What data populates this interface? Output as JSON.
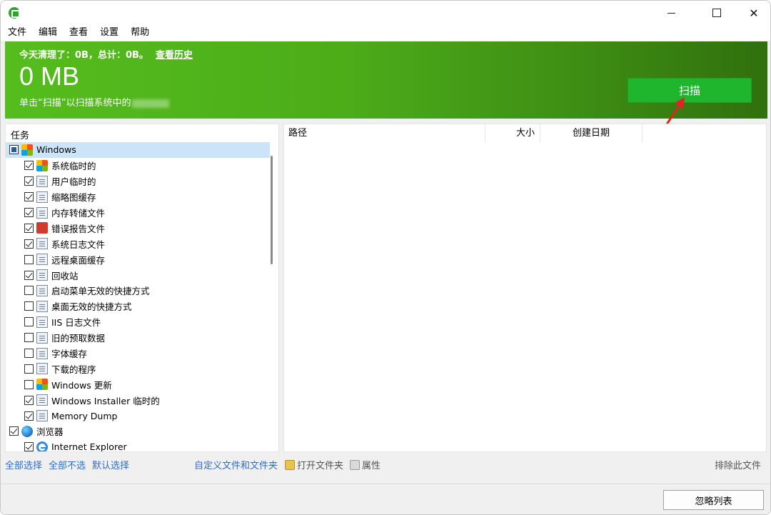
{
  "menu": [
    "文件",
    "编辑",
    "查看",
    "设置",
    "帮助"
  ],
  "banner": {
    "today_text": "今天清理了：0B，总计：0B。",
    "history_link": "查看历史",
    "total_size": "0 MB",
    "hint": "单击“扫描”以扫描系统中的",
    "scan_button": "扫描"
  },
  "tasks": {
    "header": "任务",
    "items": [
      {
        "label": "Windows",
        "level": 0,
        "check": "partial",
        "icon": "windows-icon",
        "selected": true
      },
      {
        "label": "系统临时的",
        "level": 1,
        "check": "checked",
        "icon": "windows-icon"
      },
      {
        "label": "用户临时的",
        "level": 1,
        "check": "checked",
        "icon": "document-icon"
      },
      {
        "label": "缩略图缓存",
        "level": 1,
        "check": "checked",
        "icon": "document-icon"
      },
      {
        "label": "内存转储文件",
        "level": 1,
        "check": "checked",
        "icon": "document-icon"
      },
      {
        "label": "错误报告文件",
        "level": 1,
        "check": "checked",
        "icon": "error-report-icon"
      },
      {
        "label": "系统日志文件",
        "level": 1,
        "check": "checked",
        "icon": "document-icon"
      },
      {
        "label": "远程桌面缓存",
        "level": 1,
        "check": "unchecked",
        "icon": "document-icon"
      },
      {
        "label": "回收站",
        "level": 1,
        "check": "checked",
        "icon": "document-icon"
      },
      {
        "label": "启动菜单无效的快捷方式",
        "level": 1,
        "check": "unchecked",
        "icon": "document-icon"
      },
      {
        "label": "桌面无效的快捷方式",
        "level": 1,
        "check": "unchecked",
        "icon": "document-icon"
      },
      {
        "label": "IIS 日志文件",
        "level": 1,
        "check": "unchecked",
        "icon": "document-icon"
      },
      {
        "label": "旧的预取数据",
        "level": 1,
        "check": "unchecked",
        "icon": "document-icon"
      },
      {
        "label": "字体缓存",
        "level": 1,
        "check": "unchecked",
        "icon": "document-icon"
      },
      {
        "label": "下载的程序",
        "level": 1,
        "check": "unchecked",
        "icon": "document-icon"
      },
      {
        "label": "Windows 更新",
        "level": 1,
        "check": "unchecked",
        "icon": "windows-icon"
      },
      {
        "label": "Windows Installer 临时的",
        "level": 1,
        "check": "checked",
        "icon": "document-icon"
      },
      {
        "label": "Memory Dump",
        "level": 1,
        "check": "checked",
        "icon": "document-icon"
      },
      {
        "label": "浏览器",
        "level": 0,
        "check": "checked",
        "icon": "globe-icon"
      },
      {
        "label": "Internet Explorer",
        "level": 1,
        "check": "checked",
        "icon": "internet-explorer-icon"
      }
    ]
  },
  "results": {
    "columns": {
      "path": "路径",
      "size": "大小",
      "created": "创建日期"
    }
  },
  "links": {
    "select_all": "全部选择",
    "select_none": "全部不选",
    "select_default": "默认选择",
    "custom_files": "自定义文件和文件夹",
    "open_folder": "打开文件夹",
    "properties": "属性",
    "exclude_file": "排除此文件"
  },
  "footer": {
    "ignore_list": "忽略列表"
  }
}
